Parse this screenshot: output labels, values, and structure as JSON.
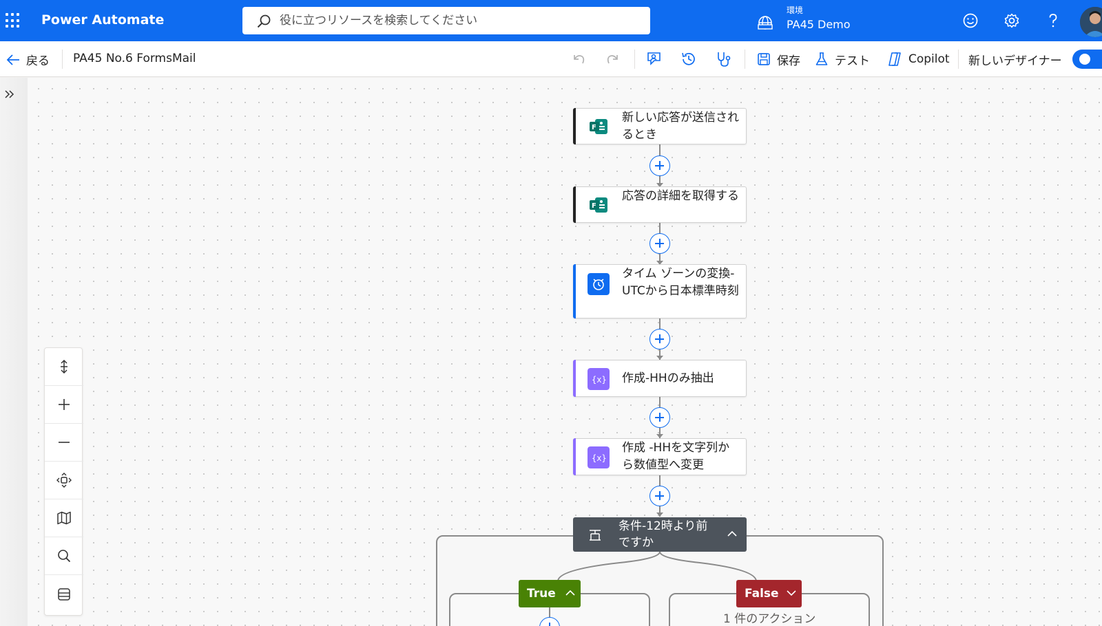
{
  "header": {
    "app_name": "Power Automate",
    "search_placeholder": "役に立つリソースを検索してください",
    "env_label": "環境",
    "env_name": "PA45 Demo"
  },
  "toolbar": {
    "back_label": "戻る",
    "flow_name": "PA45 No.6 FormsMail",
    "save_label": "保存",
    "test_label": "テスト",
    "copilot_label": "Copilot",
    "new_designer_label": "新しいデザイナー"
  },
  "flow": {
    "steps": [
      {
        "label": "新しい応答が送信されるとき",
        "icon": "forms-icon",
        "accent": "#242424"
      },
      {
        "label": "応答の詳細を取得する",
        "icon": "forms-icon",
        "accent": "#242424"
      },
      {
        "label": "タイム ゾーンの変換-UTCから日本標準時刻",
        "icon": "clock-icon",
        "accent": "#0f6cf0"
      },
      {
        "label": "作成-HHのみ抽出",
        "icon": "data-operation-icon",
        "accent": "#8c6cff"
      },
      {
        "label": "作成 -HHを文字列から数値型へ変更",
        "icon": "data-operation-icon",
        "accent": "#8c6cff"
      }
    ],
    "condition": {
      "label": "条件-12時より前ですか"
    },
    "true_branch": {
      "label": "True"
    },
    "false_branch": {
      "label": "False",
      "count_label": "1 件のアクション"
    }
  },
  "colors": {
    "brand": "#0f6cf0",
    "true": "#498205",
    "false": "#a4262c",
    "condition": "#4d545c"
  }
}
